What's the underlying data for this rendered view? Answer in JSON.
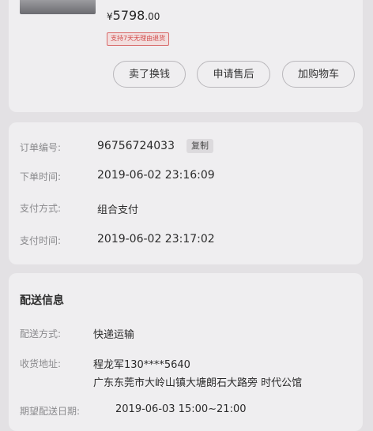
{
  "product": {
    "price_symbol": "¥",
    "price_main": "5798",
    "price_cents": ".00",
    "promo_tag": "支持7天无理由退货",
    "actions": [
      "卖了换钱",
      "申请售后",
      "加购物车"
    ]
  },
  "order_info": {
    "order_no_label": "订单编号:",
    "order_no": "96756724033",
    "copy_label": "复制",
    "order_time_label": "下单时间:",
    "order_time": "2019-06-02 23:16:09",
    "pay_method_label": "支付方式:",
    "pay_method": "组合支付",
    "pay_time_label": "支付时间:",
    "pay_time": "2019-06-02 23:17:02"
  },
  "shipping": {
    "title": "配送信息",
    "method_label": "配送方式:",
    "method": "快递运输",
    "address_label": "收货地址:",
    "recipient": "程龙军130****5640",
    "address": "广东东莞市大岭山镇大塘朗石大路旁 时代公馆",
    "expected_label": "期望配送日期:",
    "expected": "2019-06-03 15:00~21:00"
  }
}
